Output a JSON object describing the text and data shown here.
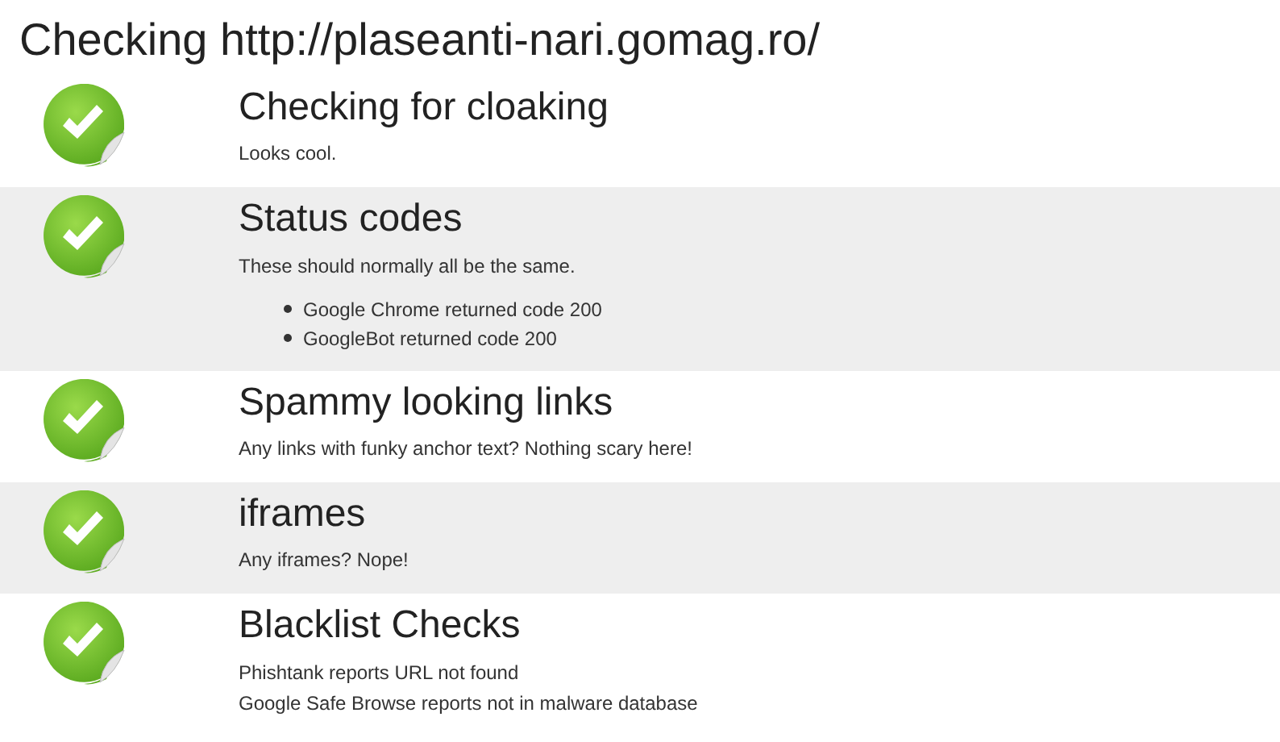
{
  "title": "Checking http://plaseanti-nari.gomag.ro/",
  "checks": [
    {
      "heading": "Checking for cloaking",
      "lines": [
        "Looks cool."
      ]
    },
    {
      "heading": "Status codes",
      "lines": [
        "These should normally all be the same."
      ],
      "bullets": [
        "Google Chrome returned code 200",
        "GoogleBot returned code 200"
      ]
    },
    {
      "heading": "Spammy looking links",
      "lines": [
        "Any links with funky anchor text? Nothing scary here!"
      ]
    },
    {
      "heading": "iframes",
      "lines": [
        "Any iframes? Nope!"
      ]
    },
    {
      "heading": "Blacklist Checks",
      "lines": [
        "Phishtank reports URL not found",
        "Google Safe Browse reports not in malware database"
      ]
    }
  ]
}
